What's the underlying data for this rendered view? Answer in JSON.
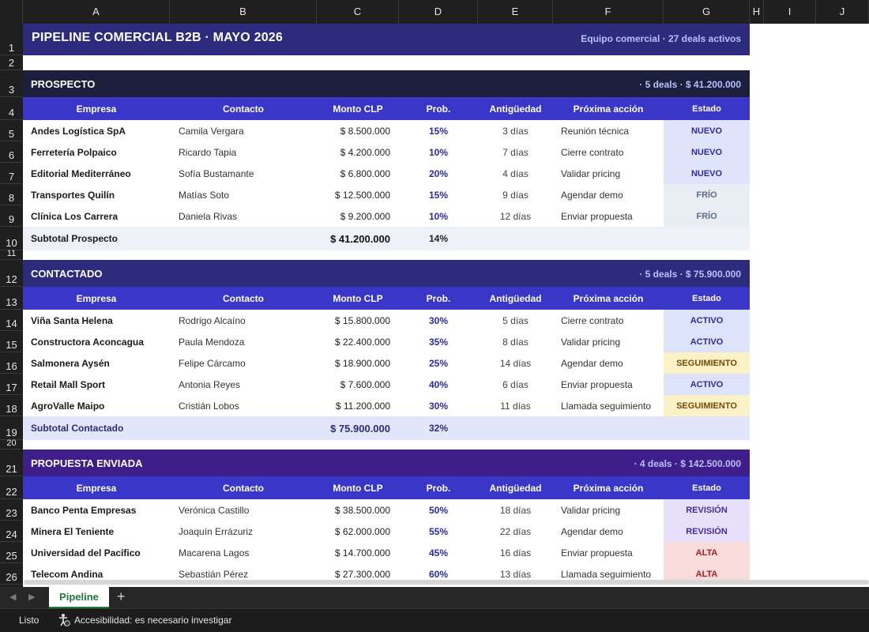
{
  "columns": [
    "A",
    "B",
    "C",
    "D",
    "E",
    "F",
    "G",
    "H",
    "I",
    "J"
  ],
  "title": {
    "left": "PIPELINE COMERCIAL B2B  ·  MAYO 2026",
    "right": "Equipo comercial  ·  27 deals activos"
  },
  "table_headers": [
    "Empresa",
    "Contacto",
    "Monto CLP",
    "Prob.",
    "Antigüedad",
    "Próxima acción",
    "Estado"
  ],
  "colors": {
    "title_bg": "#2d2b7d",
    "header_bg": "#3a37c8",
    "prospecto_bg": "#1b1f3b",
    "contactado_bg": "#2d2b7d",
    "propuesta_bg": "#3e1f8a"
  },
  "sections": [
    {
      "name": "PROSPECTO",
      "summary": "· 5 deals  ·  $ 41.200.000",
      "rows": [
        {
          "empresa": "Andes Logística SpA",
          "contacto": "Camila Vergara",
          "monto": "$ 8.500.000",
          "prob": "15%",
          "antig": "3 días",
          "accion": "Reunión técnica",
          "estado": "NUEVO"
        },
        {
          "empresa": "Ferretería Polpaico",
          "contacto": "Ricardo Tapia",
          "monto": "$ 4.200.000",
          "prob": "10%",
          "antig": "7 días",
          "accion": "Cierre contrato",
          "estado": "NUEVO"
        },
        {
          "empresa": "Editorial Mediterráneo",
          "contacto": "Sofía Bustamante",
          "monto": "$ 6.800.000",
          "prob": "20%",
          "antig": "4 días",
          "accion": "Validar pricing",
          "estado": "NUEVO"
        },
        {
          "empresa": "Transportes Quilín",
          "contacto": "Matías Soto",
          "monto": "$ 12.500.000",
          "prob": "15%",
          "antig": "9 días",
          "accion": "Agendar demo",
          "estado": "FRÍO"
        },
        {
          "empresa": "Clínica Los Carrera",
          "contacto": "Daniela Rivas",
          "monto": "$ 9.200.000",
          "prob": "10%",
          "antig": "12 días",
          "accion": "Enviar propuesta",
          "estado": "FRÍO"
        }
      ],
      "subtotal": {
        "label": "Subtotal Prospecto",
        "monto": "$ 41.200.000",
        "prob": "14%"
      }
    },
    {
      "name": "CONTACTADO",
      "summary": "· 5 deals  ·  $ 75.900.000",
      "rows": [
        {
          "empresa": "Viña Santa Helena",
          "contacto": "Rodrigo Alcaíno",
          "monto": "$ 15.800.000",
          "prob": "30%",
          "antig": "5 días",
          "accion": "Cierre contrato",
          "estado": "ACTIVO"
        },
        {
          "empresa": "Constructora Aconcagua",
          "contacto": "Paula Mendoza",
          "monto": "$ 22.400.000",
          "prob": "35%",
          "antig": "8 días",
          "accion": "Validar pricing",
          "estado": "ACTIVO"
        },
        {
          "empresa": "Salmonera Aysén",
          "contacto": "Felipe Cárcamo",
          "monto": "$ 18.900.000",
          "prob": "25%",
          "antig": "14 días",
          "accion": "Agendar demo",
          "estado": "SEGUIMIENTO"
        },
        {
          "empresa": "Retail Mall Sport",
          "contacto": "Antonia Reyes",
          "monto": "$ 7.600.000",
          "prob": "40%",
          "antig": "6 días",
          "accion": "Enviar propuesta",
          "estado": "ACTIVO"
        },
        {
          "empresa": "AgroValle Maipo",
          "contacto": "Cristián Lobos",
          "monto": "$ 11.200.000",
          "prob": "30%",
          "antig": "11 días",
          "accion": "Llamada seguimiento",
          "estado": "SEGUIMIENTO"
        }
      ],
      "subtotal": {
        "label": "Subtotal Contactado",
        "monto": "$ 75.900.000",
        "prob": "32%"
      }
    },
    {
      "name": "PROPUESTA ENVIADA",
      "summary": "· 4 deals  ·  $ 142.500.000",
      "rows": [
        {
          "empresa": "Banco Penta Empresas",
          "contacto": "Verónica Castillo",
          "monto": "$ 38.500.000",
          "prob": "50%",
          "antig": "18 días",
          "accion": "Validar pricing",
          "estado": "REVISIÓN"
        },
        {
          "empresa": "Minera El Teniente",
          "contacto": "Joaquín Errázuriz",
          "monto": "$ 62.000.000",
          "prob": "55%",
          "antig": "22 días",
          "accion": "Agendar demo",
          "estado": "REVISIÓN"
        },
        {
          "empresa": "Universidad del Pacífico",
          "contacto": "Macarena Lagos",
          "monto": "$ 14.700.000",
          "prob": "45%",
          "antig": "16 días",
          "accion": "Enviar propuesta",
          "estado": "ALTA"
        },
        {
          "empresa": "Telecom Andina",
          "contacto": "Sebastián Pérez",
          "monto": "$ 27.300.000",
          "prob": "60%",
          "antig": "13 días",
          "accion": "Llamada seguimiento",
          "estado": "ALTA"
        }
      ]
    }
  ],
  "estado_colors": {
    "NUEVO": {
      "bg": "#dfe3fb",
      "fg": "#2d2b9e"
    },
    "FRÍO": {
      "bg": "#e9eef5",
      "fg": "#5a6b85"
    },
    "ACTIVO": {
      "bg": "#dde3fa",
      "fg": "#2d2b9e"
    },
    "SEGUIMIENTO": {
      "bg": "#fdf1c7",
      "fg": "#7a4a00"
    },
    "REVISIÓN": {
      "bg": "#e6e0fa",
      "fg": "#4b2a9e"
    },
    "ALTA": {
      "bg": "#f8dcdc",
      "fg": "#b01c1c"
    }
  },
  "sheet_tab": "Pipeline",
  "add_tab": "+",
  "status": {
    "ready": "Listo",
    "accessibility": "Accesibilidad: es necesario investigar"
  }
}
